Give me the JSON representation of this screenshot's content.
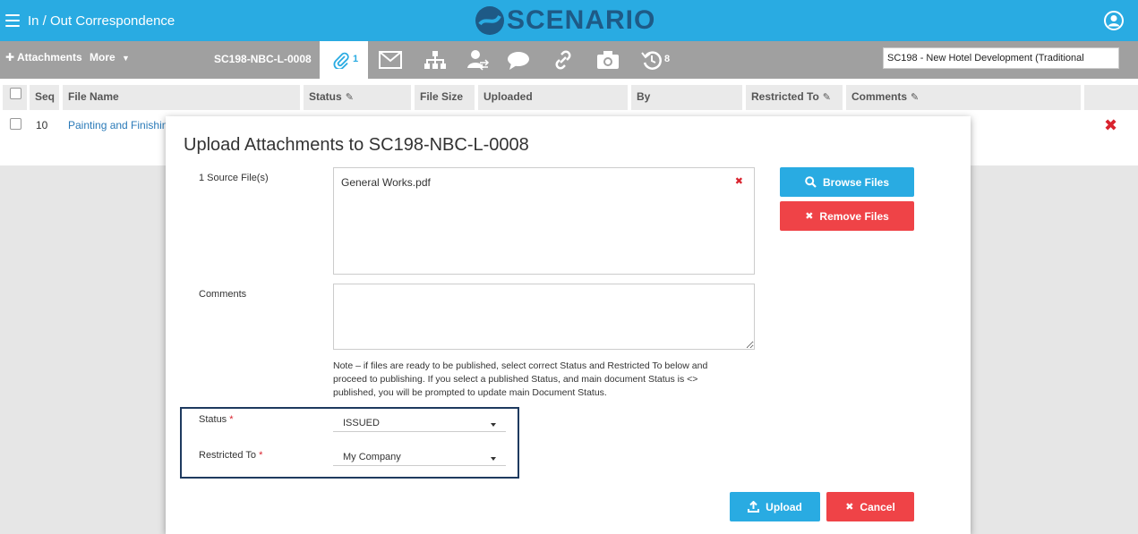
{
  "header": {
    "app_title": "In / Out Correspondence",
    "logo_text": "SCENARIO",
    "brand_color": "#29abe2",
    "logo_color": "#1e5a86"
  },
  "toolbar": {
    "attachments_label": "Attachments",
    "more_label": "More",
    "doc_number": "SC198-NBC-L-0008",
    "attachments_count": "1",
    "history_count": "8",
    "project_value": "SC198  -  New Hotel Development (Traditional"
  },
  "table": {
    "columns": [
      "Seq",
      "File Name",
      "Status",
      "File Size",
      "Uploaded",
      "By",
      "Restricted To",
      "Comments"
    ],
    "rows": [
      {
        "seq": "10",
        "file_name": "Painting and Finishin"
      }
    ]
  },
  "modal": {
    "title": "Upload Attachments to SC198-NBC-L-0008",
    "source_files_label": "1 Source File(s)",
    "files": [
      "General Works.pdf"
    ],
    "browse_label": "Browse Files",
    "remove_label": "Remove Files",
    "comments_label": "Comments",
    "comments_value": "",
    "note": "Note – if files are ready to be published, select correct Status and Restricted To below and proceed to publishing. If you select a published Status, and main document Status is <> published, you will be prompted to update main Document Status.",
    "status_label": "Status",
    "status_value": "ISSUED",
    "restricted_label": "Restricted To",
    "restricted_value": "My Company",
    "required_mark": "*",
    "upload_label": "Upload",
    "cancel_label": "Cancel"
  }
}
